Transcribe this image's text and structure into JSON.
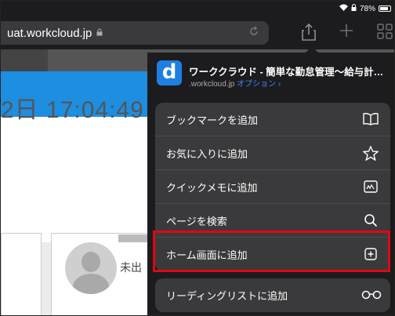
{
  "status": {
    "battery_text": "78%"
  },
  "browser": {
    "url": "uat.workcloud.jp",
    "toolbar_icons": [
      "share-icon",
      "new-tab-icon",
      "tabs-icon"
    ]
  },
  "page": {
    "time_text": "2日 17:04:49",
    "status_text": "未出"
  },
  "share_sheet": {
    "site_title": "ワーククラウド - 簡単な勤怠管理～給与計…",
    "site_domain": ".workcloud.jp",
    "options_label": "オプション ›",
    "site_icon_letter": "d",
    "items": [
      {
        "label": "ブックマークを追加",
        "icon": "book-icon"
      },
      {
        "label": "お気に入りに追加",
        "icon": "star-icon"
      },
      {
        "label": "クイックメモに追加",
        "icon": "quick-note-icon"
      },
      {
        "label": "ページを検索",
        "icon": "search-icon"
      },
      {
        "label": "ホーム画面に追加",
        "icon": "add-square-icon"
      },
      {
        "label": "リーディングリストに追加",
        "icon": "glasses-icon"
      }
    ]
  },
  "colors": {
    "accent_blue": "#1d8ee0",
    "highlight_red": "#e30613",
    "menu_bg": "#3a3a3c"
  }
}
